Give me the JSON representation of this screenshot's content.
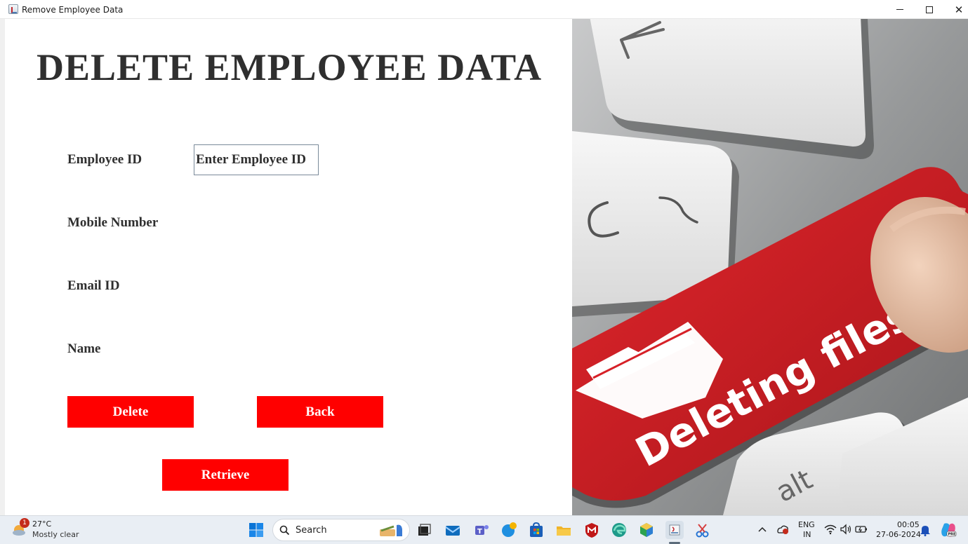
{
  "window": {
    "title": "Remove Employee Data"
  },
  "form": {
    "heading": "DELETE EMPLOYEE DATA",
    "employee_id_label": "Employee ID",
    "employee_id_value": "Enter Employee ID",
    "mobile_label": "Mobile Number",
    "email_label": "Email ID",
    "name_label": "Name",
    "delete_label": "Delete",
    "back_label": "Back",
    "retrieve_label": "Retrieve"
  },
  "image": {
    "key_text": "Deleting files",
    "alt_key_text": "alt"
  },
  "colors": {
    "button_bg": "#ff0000",
    "button_text": "#ffffff",
    "heading_text": "#2f2f2f",
    "key_red": "#d62027"
  },
  "taskbar": {
    "weather_badge": "1",
    "temperature": "27°C",
    "condition": "Mostly clear",
    "search_label": "Search",
    "lang_top": "ENG",
    "lang_bottom": "IN",
    "time": "00:05",
    "date": "27-06-2024",
    "icons": [
      "windows-start-icon",
      "search-icon",
      "task-view-icon",
      "mail-icon",
      "teams-icon",
      "edge-beta-icon",
      "store-icon",
      "file-explorer-icon",
      "mcafee-icon",
      "edge-icon",
      "copilot-icon",
      "java-app-icon",
      "snipping-tool-icon",
      "chevron-up-icon",
      "onedrive-icon",
      "wifi-icon",
      "volume-icon",
      "battery-icon",
      "bell-icon",
      "copilot-pre-icon"
    ]
  }
}
